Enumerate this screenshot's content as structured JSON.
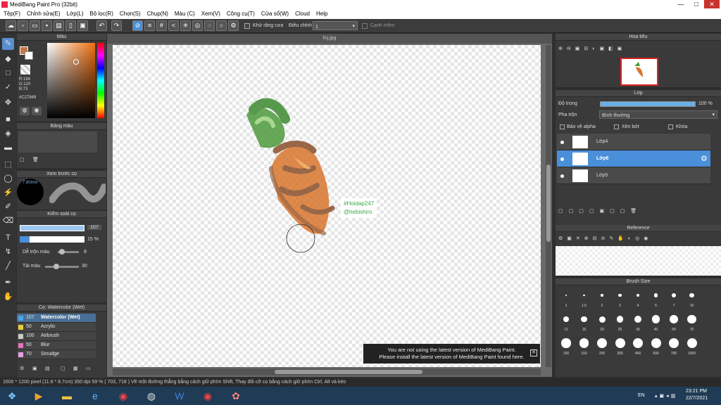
{
  "app": {
    "title": "MediBang Paint Pro (32bit)"
  },
  "menu": [
    "Tệp(F)",
    "Chỉnh sửa(E)",
    "Lớp(L)",
    "Bộ lọc(R)",
    "Chọn(S)",
    "Chụp(N)",
    "Màu (C)",
    "Xem(V)",
    "Công cụ(T)",
    "Cửa sổ(W)",
    "Cloud",
    "Help"
  ],
  "toolbar": {
    "antialias": "Khử răng cưa",
    "adjust": "Điều chỉnh",
    "adjust_value": "1",
    "smooth": "Cạnh mềm"
  },
  "color": {
    "panel_title": "Màu",
    "r": "R:194",
    "g": "G:120",
    "b": "B:73",
    "hex": "#C27849",
    "fg": "#C27849"
  },
  "palette": {
    "title": "Bảng màu"
  },
  "brush_preview": {
    "title": "Xem trước cọ",
    "size": "7.80mm"
  },
  "brush_control": {
    "title": "Kiểm soát cọ",
    "size": "107",
    "opacity": "15 %",
    "blend_label": "Dễ trộn màu",
    "blend_value": "8",
    "reload_label": "Tải màu",
    "reload_value": "30"
  },
  "brush_list": {
    "title": "Cọ: Watercolor (Wet)",
    "items": [
      {
        "size": "107",
        "name": "Watercolor (Wet)",
        "color": "#4aa3e8"
      },
      {
        "size": "50",
        "name": "Acrylic",
        "color": "#e8d030"
      },
      {
        "size": "100",
        "name": "Airbrush",
        "color": "#cccccc"
      },
      {
        "size": "50",
        "name": "Blur",
        "color": "#e870c0"
      },
      {
        "size": "70",
        "name": "Smudge",
        "color": "#e8a0e0"
      }
    ]
  },
  "document": {
    "tab": "fnj.jpg"
  },
  "artwork": {
    "caption1": "#Hoidap247",
    "caption2": "@hebishiro"
  },
  "notice": {
    "line1": "You are not using the latest version of MediBang Paint.",
    "line2": "Please install the latest version of MediBang Paint found here."
  },
  "status": {
    "text": "1600 * 1200 pixel   (11.6 * 8.7cm)   350 dpi   59 %   ( 703, 718 )   Vẽ một đường thẳng bằng cách giữ phím Shift, Thay đổi cỡ cọ bằng cách giữ phím Ctrl, Alt và kéo"
  },
  "navigator": {
    "title": "Hoa tiêu"
  },
  "layer_panel": {
    "title": "Lớp",
    "opacity_label": "Độ trong",
    "opacity_value": "100 %",
    "blend_label": "Pha trộn",
    "blend_value": "Bình thường",
    "protect_alpha": "Bảo vệ alpha",
    "clip": "Xén bớt",
    "lock": "Khóa",
    "layers": [
      {
        "name": "Lớp4"
      },
      {
        "name": "Lớp6"
      },
      {
        "name": "Lớp5"
      }
    ]
  },
  "reference": {
    "title": "Reference"
  },
  "brush_size": {
    "title": "Brush Size",
    "sizes": [
      "1",
      "1.5",
      "2",
      "3",
      "4",
      "5",
      "7",
      "10",
      "12",
      "15",
      "20",
      "25",
      "30",
      "40",
      "50",
      "70",
      "100",
      "150",
      "200",
      "300",
      "400",
      "500",
      "700",
      "1000"
    ]
  },
  "taskbar": {
    "lang": "EN",
    "time": "23:21 PM",
    "date": "22/7/2021"
  }
}
